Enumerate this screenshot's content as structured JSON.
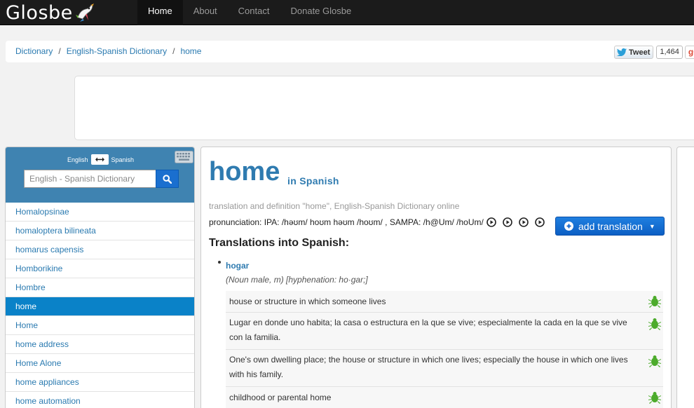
{
  "app": {
    "logo_text": "Glosbe"
  },
  "nav": {
    "items": [
      {
        "label": "Home",
        "active": true
      },
      {
        "label": "About",
        "active": false
      },
      {
        "label": "Contact",
        "active": false
      },
      {
        "label": "Donate Glosbe",
        "active": false
      }
    ]
  },
  "breadcrumb": {
    "items": [
      "Dictionary",
      "English-Spanish Dictionary",
      "home"
    ],
    "separator": "/"
  },
  "social": {
    "tweet_label": "Tweet",
    "tweet_count": "1,464",
    "gplus_label": "g+"
  },
  "sidebar": {
    "lang_from": "English",
    "lang_to": "Spanish",
    "swap_icon": "swap-arrows-icon",
    "keyboard_icon": "keyboard-icon",
    "search": {
      "placeholder": "English - Spanish Dictionary",
      "value": ""
    },
    "search_icon": "search-icon",
    "items": [
      {
        "label": "Homalopsinae",
        "active": false
      },
      {
        "label": "homaloptera bilineata",
        "active": false
      },
      {
        "label": "homarus capensis",
        "active": false
      },
      {
        "label": "Homborikine",
        "active": false
      },
      {
        "label": "Hombre",
        "active": false
      },
      {
        "label": "home",
        "active": true
      },
      {
        "label": "Home",
        "active": false
      },
      {
        "label": "home address",
        "active": false
      },
      {
        "label": "Home Alone",
        "active": false
      },
      {
        "label": "home appliances",
        "active": false
      },
      {
        "label": "home automation",
        "active": false
      }
    ]
  },
  "main": {
    "headword": "home",
    "in_lang": "in Spanish",
    "subtitle": "translation and definition \"home\", English-Spanish Dictionary  online",
    "pronunciation": "pronunciation: IPA: /həʊm/ hoʊm həʊm /hoʊm/ , SAMPA: /h@Um/ /hoUm/",
    "play_buttons": 4,
    "add_translation_label": "add translation",
    "section_title": "Translations into Spanish:",
    "translation": {
      "word": "hogar",
      "meta": "(Noun  male, m) [hyphenation: ho·gar;]",
      "definitions": [
        "house or structure in which someone lives",
        "Lugar en donde uno habita; la casa o estructura en la que se vive; especialmente la cada en la que se vive con la familia.",
        "One's own dwelling place; the house or structure in which one lives; especially the house in which one lives with his family.",
        "childhood or parental home"
      ]
    }
  },
  "colors": {
    "topbar": "#1b1b1b",
    "accent_blue": "#2f7bb0",
    "sidebar_header": "#3f83b1",
    "active_item": "#0a82c8",
    "button_blue": "#1a6fcf",
    "bug_green": "#4cab2b"
  }
}
